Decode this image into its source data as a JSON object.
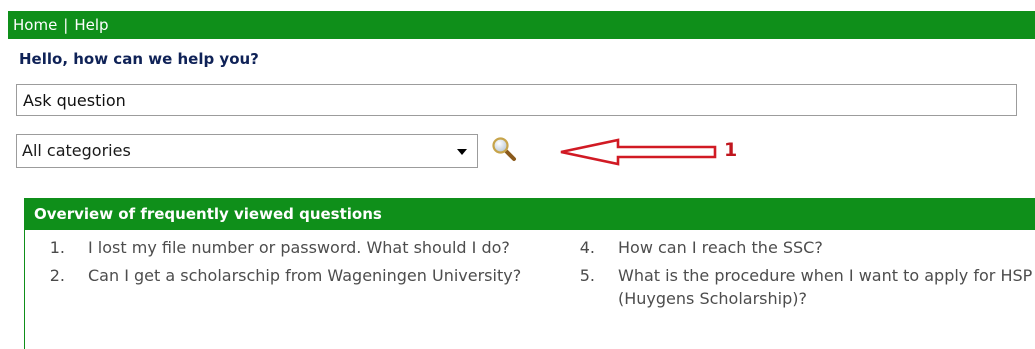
{
  "nav": {
    "home": "Home",
    "separator": "|",
    "help": "Help"
  },
  "greeting": "Hello, how can we help you?",
  "search": {
    "value": "Ask question"
  },
  "category": {
    "selected": "All categories"
  },
  "annotation": {
    "label": "1",
    "color": "#c0161e"
  },
  "faq": {
    "title": "Overview of frequently viewed questions",
    "left": [
      {
        "num": "1.",
        "text": "I lost my file number or password. What should I do?"
      },
      {
        "num": "2.",
        "text": "Can I get a scholarschip from Wageningen University?"
      }
    ],
    "right": [
      {
        "num": "4.",
        "text": "How can I reach the SSC?"
      },
      {
        "num": "5.",
        "text": "What is the procedure when I want to apply for HSP (Huygens Scholarship)?"
      }
    ]
  },
  "colors": {
    "brand_green": "#0f8f1a",
    "heading_blue": "#0f2257"
  },
  "icons": {
    "search": "magnifier-icon",
    "dropdown": "chevron-down-icon"
  }
}
